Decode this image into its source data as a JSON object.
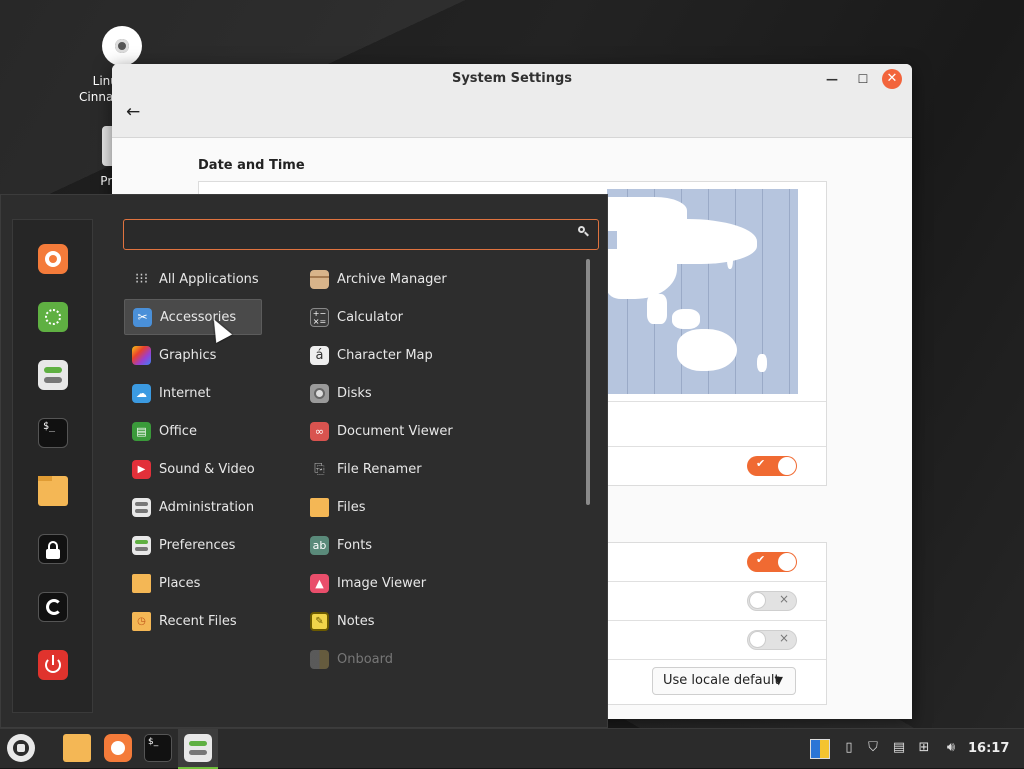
{
  "desktop": {
    "icons": [
      {
        "label": "Linux\nCinnam",
        "icon": "disc-icon"
      },
      {
        "label": "Prep",
        "icon": "document-icon"
      }
    ]
  },
  "window": {
    "title": "System Settings",
    "section_title": "Date and Time",
    "dropdown_value": "Use locale default"
  },
  "menu": {
    "search_placeholder": "",
    "favorites": [
      "firefox-icon",
      "software-manager-icon",
      "system-settings-icon",
      "terminal-icon",
      "files-icon",
      "lock-screen-icon",
      "logout-icon",
      "shutdown-icon"
    ],
    "categories": [
      {
        "label": "All Applications",
        "icon": "grid-icon"
      },
      {
        "label": "Accessories",
        "icon": "scissors-icon",
        "selected": true
      },
      {
        "label": "Graphics",
        "icon": "graphics-icon"
      },
      {
        "label": "Internet",
        "icon": "cloud-icon"
      },
      {
        "label": "Office",
        "icon": "office-icon"
      },
      {
        "label": "Sound & Video",
        "icon": "play-icon"
      },
      {
        "label": "Administration",
        "icon": "administration-icon"
      },
      {
        "label": "Preferences",
        "icon": "preferences-icon"
      },
      {
        "label": "Places",
        "icon": "folder-icon"
      },
      {
        "label": "Recent Files",
        "icon": "recent-files-icon"
      }
    ],
    "apps": [
      {
        "label": "Archive Manager",
        "icon": "archive-icon"
      },
      {
        "label": "Calculator",
        "icon": "calculator-icon"
      },
      {
        "label": "Character Map",
        "icon": "character-map-icon"
      },
      {
        "label": "Disks",
        "icon": "disks-icon"
      },
      {
        "label": "Document Viewer",
        "icon": "document-viewer-icon"
      },
      {
        "label": "File Renamer",
        "icon": "file-renamer-icon"
      },
      {
        "label": "Files",
        "icon": "folder-icon"
      },
      {
        "label": "Fonts",
        "icon": "fonts-icon"
      },
      {
        "label": "Image Viewer",
        "icon": "image-viewer-icon"
      },
      {
        "label": "Notes",
        "icon": "notes-icon"
      },
      {
        "label": "Onboard",
        "icon": "onboard-icon",
        "disabled": true
      }
    ]
  },
  "taskbar": {
    "clock": "16:17",
    "accent": "#6fbf3a"
  },
  "colors": {
    "accent_orange": "#f06a32",
    "menu_bg": "#2d2d2d"
  }
}
